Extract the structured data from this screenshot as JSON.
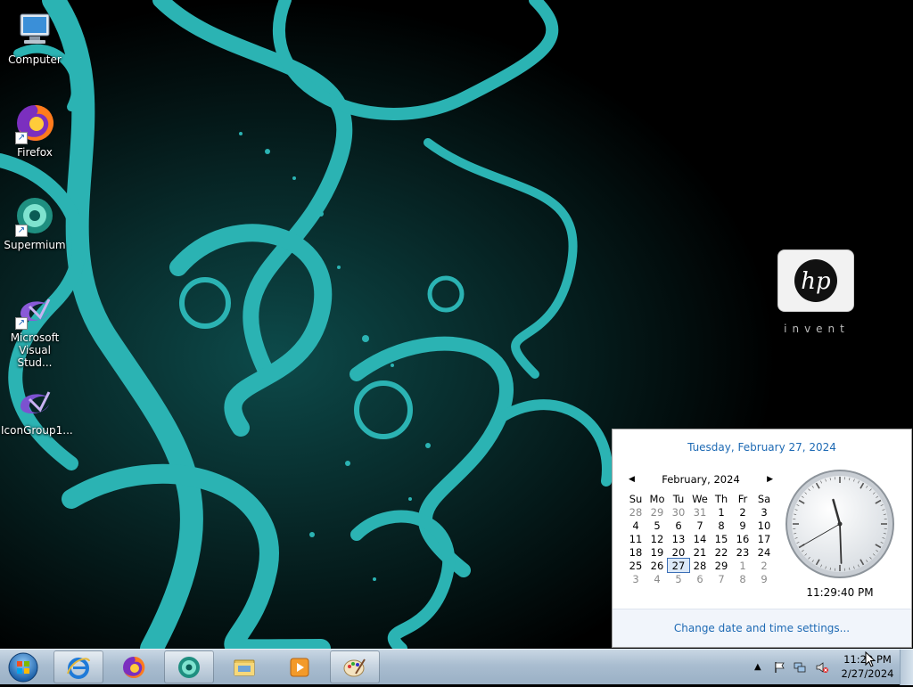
{
  "desktop": {
    "icons": [
      {
        "label": "Computer"
      },
      {
        "label": "Firefox"
      },
      {
        "label": "Supermium"
      },
      {
        "label": "Microsoft Visual Stud..."
      },
      {
        "label": "IconGroup1..."
      }
    ],
    "hp_logo": {
      "text": "hp",
      "tagline": "invent"
    }
  },
  "calendar_flyout": {
    "date_header": "Tuesday, February 27, 2024",
    "month_label": "February, 2024",
    "weekdays": [
      "Su",
      "Mo",
      "Tu",
      "We",
      "Th",
      "Fr",
      "Sa"
    ],
    "weeks": [
      [
        {
          "d": "28",
          "o": true
        },
        {
          "d": "29",
          "o": true
        },
        {
          "d": "30",
          "o": true
        },
        {
          "d": "31",
          "o": true
        },
        {
          "d": "1"
        },
        {
          "d": "2"
        },
        {
          "d": "3"
        }
      ],
      [
        {
          "d": "4"
        },
        {
          "d": "5"
        },
        {
          "d": "6"
        },
        {
          "d": "7"
        },
        {
          "d": "8"
        },
        {
          "d": "9"
        },
        {
          "d": "10"
        }
      ],
      [
        {
          "d": "11"
        },
        {
          "d": "12"
        },
        {
          "d": "13"
        },
        {
          "d": "14"
        },
        {
          "d": "15"
        },
        {
          "d": "16"
        },
        {
          "d": "17"
        }
      ],
      [
        {
          "d": "18"
        },
        {
          "d": "19"
        },
        {
          "d": "20"
        },
        {
          "d": "21"
        },
        {
          "d": "22"
        },
        {
          "d": "23"
        },
        {
          "d": "24"
        }
      ],
      [
        {
          "d": "25"
        },
        {
          "d": "26"
        },
        {
          "d": "27",
          "today": true
        },
        {
          "d": "28"
        },
        {
          "d": "29"
        },
        {
          "d": "1",
          "o": true
        },
        {
          "d": "2",
          "o": true
        }
      ],
      [
        {
          "d": "3",
          "o": true
        },
        {
          "d": "4",
          "o": true
        },
        {
          "d": "5",
          "o": true
        },
        {
          "d": "6",
          "o": true
        },
        {
          "d": "7",
          "o": true
        },
        {
          "d": "8",
          "o": true
        },
        {
          "d": "9",
          "o": true
        }
      ]
    ],
    "clock_time": "11:29:40 PM",
    "clock": {
      "hour": 23,
      "minute": 29,
      "second": 40
    },
    "settings_link": "Change date and time settings..."
  },
  "taskbar": {
    "start_icon": "windows-orb-icon",
    "pinned": [
      {
        "name": "internet-explorer-icon"
      },
      {
        "name": "firefox-icon"
      },
      {
        "name": "supermium-icon"
      },
      {
        "name": "windows-explorer-icon"
      },
      {
        "name": "media-player-icon"
      },
      {
        "name": "paint-icon"
      }
    ],
    "tray_time": "11:29 PM",
    "tray_date": "2/27/2024"
  },
  "colors": {
    "accent": "#1e6ab4",
    "teal": "#2bb3b3"
  }
}
